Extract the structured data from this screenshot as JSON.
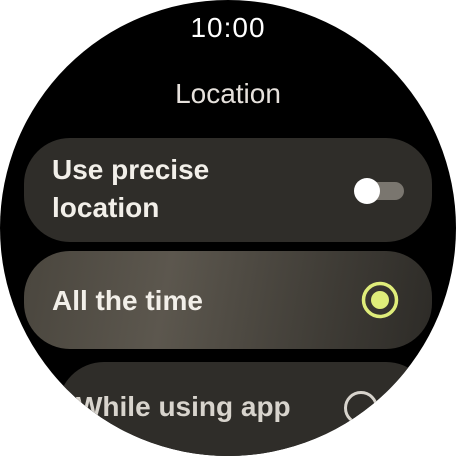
{
  "status": {
    "time": "10:00"
  },
  "header": {
    "title": "Location"
  },
  "settings": {
    "precise": {
      "label": "Use precise location",
      "enabled": false
    },
    "options": [
      {
        "label": "All the time",
        "selected": true
      },
      {
        "label": "While using app",
        "selected": false
      }
    ]
  },
  "colors": {
    "accent": "#dfed7a",
    "chip_bg": "#2f2d29",
    "background": "#000000"
  }
}
